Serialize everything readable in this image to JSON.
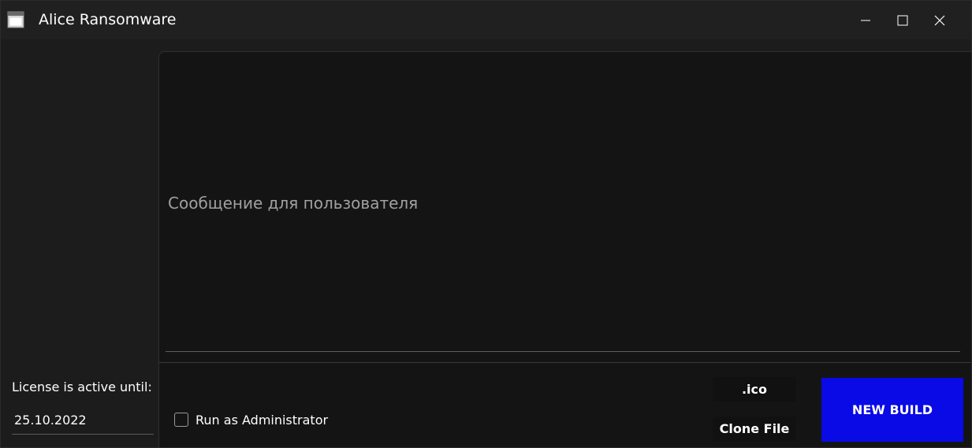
{
  "window": {
    "title": "Alice Ransomware",
    "icon": "app-window-icon",
    "controls": [
      "minimize-icon",
      "maximize-icon",
      "close-icon"
    ]
  },
  "sidebar": {
    "license_label": "License is active until:",
    "license_date": "25.10.2022"
  },
  "main": {
    "message_placeholder": "Сообщение для пользователя",
    "run_as_admin_label": "Run as Administrator",
    "run_as_admin_checked": false,
    "ico_button_label": ".ico",
    "clone_file_button_label": "Clone File",
    "new_build_button_label": "NEW BUILD"
  },
  "colors": {
    "background": "#1c1c1c",
    "content_background": "#141414",
    "accent_build_button": "#0a0ae6",
    "text": "#ffffff",
    "placeholder_text": "#a0a0a0"
  }
}
